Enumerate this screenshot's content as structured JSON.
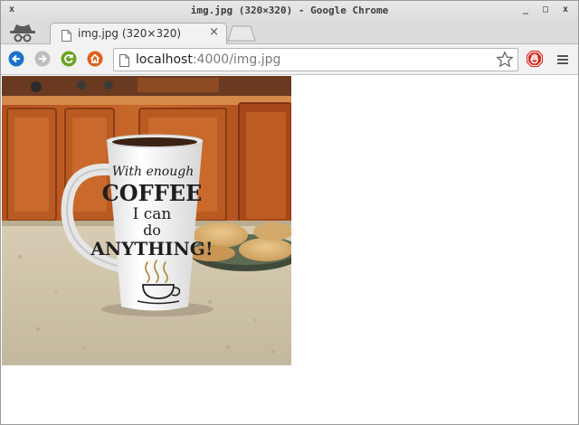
{
  "window": {
    "title": "img.jpg (320×320) - Google Chrome",
    "controls": {
      "close": "x",
      "minimize": "_",
      "maximize": "□",
      "close_right": "x"
    }
  },
  "tab": {
    "title": "img.jpg (320×320)",
    "close": "×"
  },
  "omnibox": {
    "host": "localhost",
    "rest": ":4000/img.jpg"
  },
  "colors": {
    "back": "#1a73c9",
    "forward": "#bdbdbd",
    "reload": "#6aa525",
    "home": "#e0611e",
    "extension": "#d32a1f"
  },
  "icons": {
    "back": "arrow-left-icon",
    "forward": "arrow-right-icon",
    "reload": "reload-icon",
    "home": "home-icon",
    "bookmark": "star-icon",
    "extension": "stop-hand-icon",
    "menu": "hamburger-menu-icon",
    "incognito": "incognito-icon"
  },
  "image": {
    "mug_text": [
      "With enough",
      "COFFEE",
      "I can",
      "do",
      "ANYTHING!"
    ]
  }
}
